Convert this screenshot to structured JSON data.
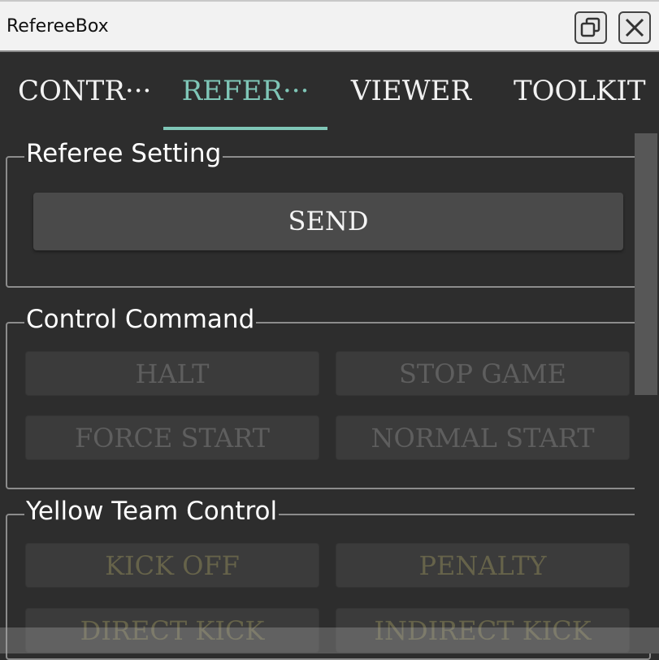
{
  "window": {
    "title": "RefereeBox",
    "restore_icon": "restore-window-icon",
    "close_icon": "close-icon"
  },
  "tabs": [
    {
      "label": "CONTR···",
      "active": false
    },
    {
      "label": "REFER···",
      "active": true
    },
    {
      "label": "VIEWER",
      "active": false
    },
    {
      "label": "TOOLKIT",
      "active": false
    }
  ],
  "colors": {
    "accent": "#7fc6b7",
    "background": "#2d2d2d",
    "button": "#4a4a4a",
    "disabled_text": "#5e5e5e",
    "yellow_disabled_text": "#66634a"
  },
  "referee_setting": {
    "title": "Referee Setting",
    "send_label": "SEND"
  },
  "control_command": {
    "title": "Control Command",
    "buttons": [
      "HALT",
      "STOP GAME",
      "FORCE START",
      "NORMAL START"
    ]
  },
  "yellow_team_control": {
    "title": "Yellow Team Control",
    "buttons": [
      "KICK OFF",
      "PENALTY",
      "DIRECT KICK",
      "INDIRECT KICK"
    ]
  }
}
